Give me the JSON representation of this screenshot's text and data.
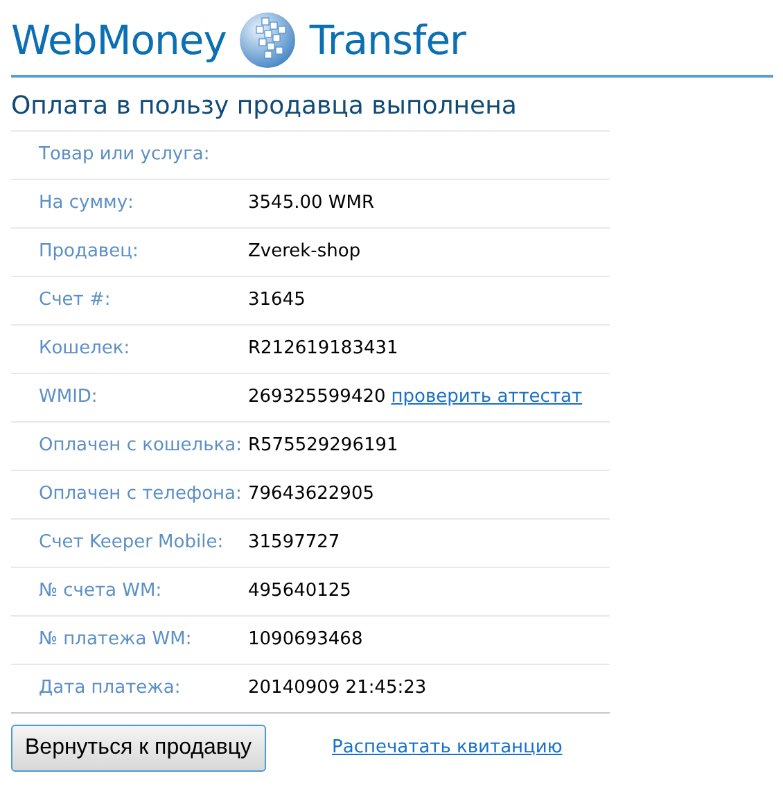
{
  "logo": {
    "left": "WebMoney",
    "right": "Transfer"
  },
  "title": "Оплата в пользу продавца выполнена",
  "rows": [
    {
      "label": "Товар или услуга:",
      "value": ""
    },
    {
      "label": "На сумму:",
      "value": "3545.00 WMR"
    },
    {
      "label": "Продавец:",
      "value": "Zverek-shop"
    },
    {
      "label": "Счет #:",
      "value": "31645"
    },
    {
      "label": "Кошелек:",
      "value": "R212619183431"
    },
    {
      "label": "WMID:",
      "value": "269325599420",
      "link": "проверить аттестат"
    },
    {
      "label": "Оплачен с кошелька:",
      "value": "R575529296191"
    },
    {
      "label": "Оплачен с телефона:",
      "value": "79643622905"
    },
    {
      "label": "Счет Keeper Mobile:",
      "value": "31597727"
    },
    {
      "label": "№ счета WM:",
      "value": "495640125"
    },
    {
      "label": "№ платежа WM:",
      "value": "1090693468"
    },
    {
      "label": "Дата платежа:",
      "value": "20140909 21:45:23"
    }
  ],
  "back_button": "Вернуться к продавцу",
  "print_link": "Распечатать квитанцию"
}
